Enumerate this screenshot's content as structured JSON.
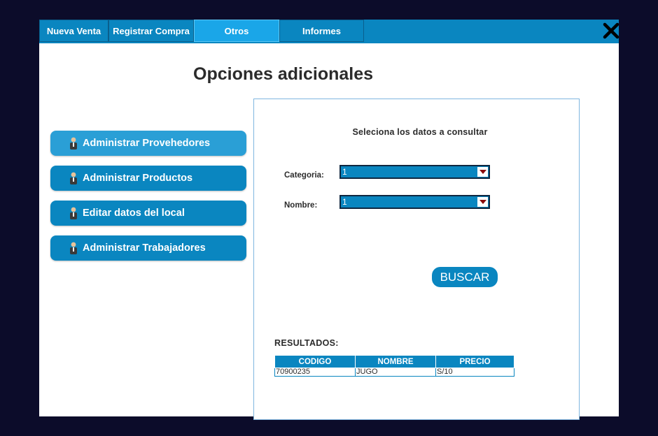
{
  "tabs": [
    {
      "label": "Nueva Venta",
      "active": false
    },
    {
      "label": "Registrar Compra",
      "active": false
    },
    {
      "label": "Otros",
      "active": true
    },
    {
      "label": "Informes",
      "active": false
    }
  ],
  "page_title": "Opciones adicionales",
  "sidebar": {
    "items": [
      {
        "label": "Administrar Provehedores",
        "icon": "user-icon"
      },
      {
        "label": "Administrar Productos",
        "icon": "user-icon"
      },
      {
        "label": "Editar datos del local",
        "icon": "user-icon"
      },
      {
        "label": "Administrar Trabajadores",
        "icon": "user-icon"
      }
    ]
  },
  "query_panel": {
    "heading": "Seleciona los datos a consultar",
    "categoria_label": "Categoria:",
    "categoria_value": "1",
    "nombre_label": "Nombre:",
    "nombre_value": "1",
    "search_label": "BUSCAR"
  },
  "results": {
    "label": "RESULTADOS:",
    "columns": [
      "CODIGO",
      "NOMBRE",
      "PRECIO"
    ],
    "rows": [
      [
        "70900235",
        "JUGO",
        "S/10"
      ]
    ]
  },
  "colors": {
    "accent": "#0a86c0",
    "active_tab": "#1aa6e8",
    "background": "#0c0c2a"
  }
}
